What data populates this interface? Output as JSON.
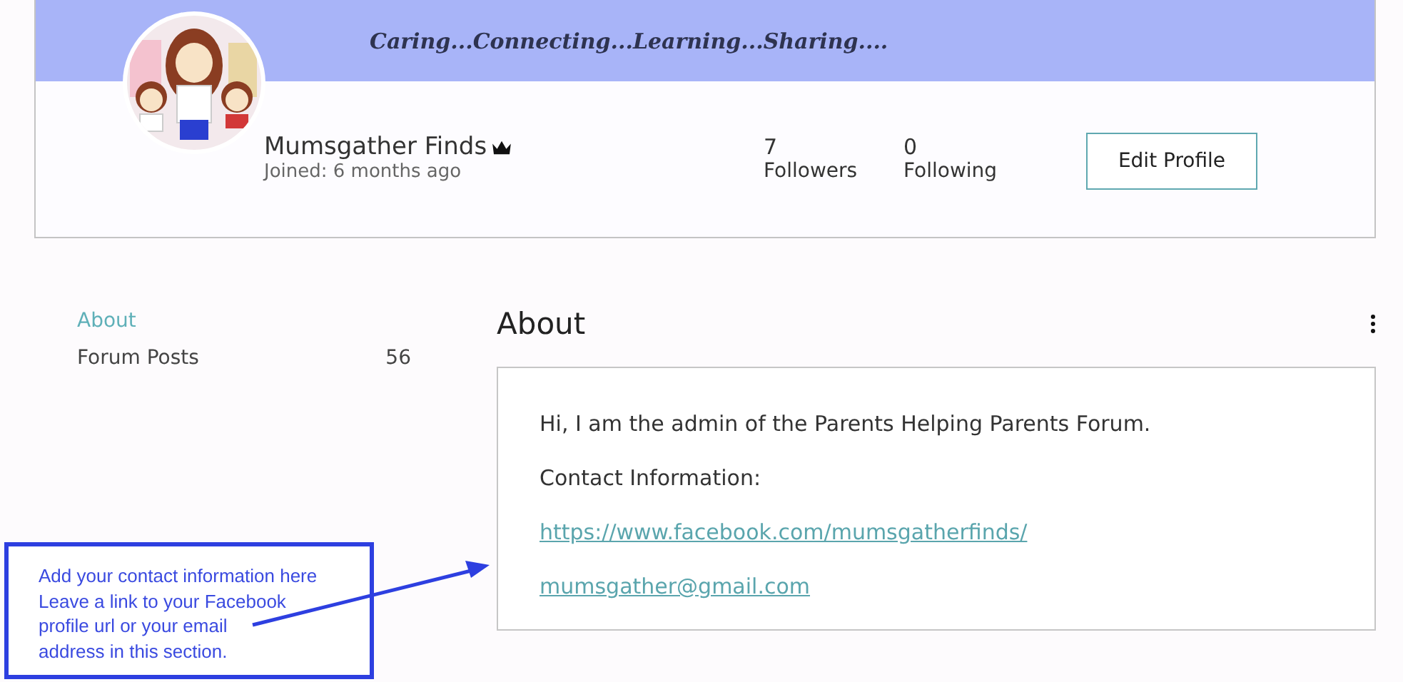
{
  "banner": {
    "tagline": "Caring...Connecting...Learning...Sharing...."
  },
  "profile": {
    "name": "Mumsgather Finds",
    "joined": "Joined: 6 months ago",
    "stats": [
      {
        "value": "7",
        "label": "Followers"
      },
      {
        "value": "0",
        "label": "Following"
      }
    ],
    "button": "Edit Profile"
  },
  "sidebar": {
    "items": [
      {
        "label": "About",
        "selected": true
      },
      {
        "label": "Forum Posts",
        "count": "56",
        "selected": false
      }
    ]
  },
  "about": {
    "title": "About",
    "lines": [
      {
        "kind": "text",
        "text": "Hi, I am the admin of the Parents Helping Parents Forum."
      },
      {
        "kind": "text",
        "text": "Contact Information:"
      },
      {
        "kind": "link",
        "text": "https://www.facebook.com/mumsgatherfinds/"
      },
      {
        "kind": "link",
        "text": "mumsgather@gmail.com"
      }
    ]
  },
  "annotation": {
    "lines": [
      "Add your contact information here",
      "Leave a link to your Facebook",
      "profile url or your email",
      "address in this section."
    ]
  }
}
